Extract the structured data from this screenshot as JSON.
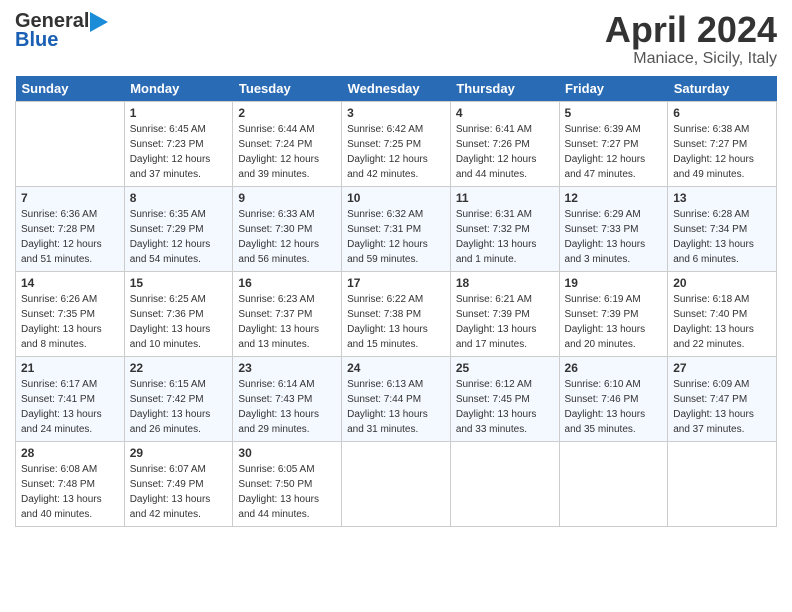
{
  "header": {
    "logo_general": "General",
    "logo_blue": "Blue",
    "month_title": "April 2024",
    "location": "Maniace, Sicily, Italy"
  },
  "days_of_week": [
    "Sunday",
    "Monday",
    "Tuesday",
    "Wednesday",
    "Thursday",
    "Friday",
    "Saturday"
  ],
  "weeks": [
    [
      {
        "num": "",
        "info": ""
      },
      {
        "num": "1",
        "info": "Sunrise: 6:45 AM\nSunset: 7:23 PM\nDaylight: 12 hours\nand 37 minutes."
      },
      {
        "num": "2",
        "info": "Sunrise: 6:44 AM\nSunset: 7:24 PM\nDaylight: 12 hours\nand 39 minutes."
      },
      {
        "num": "3",
        "info": "Sunrise: 6:42 AM\nSunset: 7:25 PM\nDaylight: 12 hours\nand 42 minutes."
      },
      {
        "num": "4",
        "info": "Sunrise: 6:41 AM\nSunset: 7:26 PM\nDaylight: 12 hours\nand 44 minutes."
      },
      {
        "num": "5",
        "info": "Sunrise: 6:39 AM\nSunset: 7:27 PM\nDaylight: 12 hours\nand 47 minutes."
      },
      {
        "num": "6",
        "info": "Sunrise: 6:38 AM\nSunset: 7:27 PM\nDaylight: 12 hours\nand 49 minutes."
      }
    ],
    [
      {
        "num": "7",
        "info": "Sunrise: 6:36 AM\nSunset: 7:28 PM\nDaylight: 12 hours\nand 51 minutes."
      },
      {
        "num": "8",
        "info": "Sunrise: 6:35 AM\nSunset: 7:29 PM\nDaylight: 12 hours\nand 54 minutes."
      },
      {
        "num": "9",
        "info": "Sunrise: 6:33 AM\nSunset: 7:30 PM\nDaylight: 12 hours\nand 56 minutes."
      },
      {
        "num": "10",
        "info": "Sunrise: 6:32 AM\nSunset: 7:31 PM\nDaylight: 12 hours\nand 59 minutes."
      },
      {
        "num": "11",
        "info": "Sunrise: 6:31 AM\nSunset: 7:32 PM\nDaylight: 13 hours\nand 1 minute."
      },
      {
        "num": "12",
        "info": "Sunrise: 6:29 AM\nSunset: 7:33 PM\nDaylight: 13 hours\nand 3 minutes."
      },
      {
        "num": "13",
        "info": "Sunrise: 6:28 AM\nSunset: 7:34 PM\nDaylight: 13 hours\nand 6 minutes."
      }
    ],
    [
      {
        "num": "14",
        "info": "Sunrise: 6:26 AM\nSunset: 7:35 PM\nDaylight: 13 hours\nand 8 minutes."
      },
      {
        "num": "15",
        "info": "Sunrise: 6:25 AM\nSunset: 7:36 PM\nDaylight: 13 hours\nand 10 minutes."
      },
      {
        "num": "16",
        "info": "Sunrise: 6:23 AM\nSunset: 7:37 PM\nDaylight: 13 hours\nand 13 minutes."
      },
      {
        "num": "17",
        "info": "Sunrise: 6:22 AM\nSunset: 7:38 PM\nDaylight: 13 hours\nand 15 minutes."
      },
      {
        "num": "18",
        "info": "Sunrise: 6:21 AM\nSunset: 7:39 PM\nDaylight: 13 hours\nand 17 minutes."
      },
      {
        "num": "19",
        "info": "Sunrise: 6:19 AM\nSunset: 7:39 PM\nDaylight: 13 hours\nand 20 minutes."
      },
      {
        "num": "20",
        "info": "Sunrise: 6:18 AM\nSunset: 7:40 PM\nDaylight: 13 hours\nand 22 minutes."
      }
    ],
    [
      {
        "num": "21",
        "info": "Sunrise: 6:17 AM\nSunset: 7:41 PM\nDaylight: 13 hours\nand 24 minutes."
      },
      {
        "num": "22",
        "info": "Sunrise: 6:15 AM\nSunset: 7:42 PM\nDaylight: 13 hours\nand 26 minutes."
      },
      {
        "num": "23",
        "info": "Sunrise: 6:14 AM\nSunset: 7:43 PM\nDaylight: 13 hours\nand 29 minutes."
      },
      {
        "num": "24",
        "info": "Sunrise: 6:13 AM\nSunset: 7:44 PM\nDaylight: 13 hours\nand 31 minutes."
      },
      {
        "num": "25",
        "info": "Sunrise: 6:12 AM\nSunset: 7:45 PM\nDaylight: 13 hours\nand 33 minutes."
      },
      {
        "num": "26",
        "info": "Sunrise: 6:10 AM\nSunset: 7:46 PM\nDaylight: 13 hours\nand 35 minutes."
      },
      {
        "num": "27",
        "info": "Sunrise: 6:09 AM\nSunset: 7:47 PM\nDaylight: 13 hours\nand 37 minutes."
      }
    ],
    [
      {
        "num": "28",
        "info": "Sunrise: 6:08 AM\nSunset: 7:48 PM\nDaylight: 13 hours\nand 40 minutes."
      },
      {
        "num": "29",
        "info": "Sunrise: 6:07 AM\nSunset: 7:49 PM\nDaylight: 13 hours\nand 42 minutes."
      },
      {
        "num": "30",
        "info": "Sunrise: 6:05 AM\nSunset: 7:50 PM\nDaylight: 13 hours\nand 44 minutes."
      },
      {
        "num": "",
        "info": ""
      },
      {
        "num": "",
        "info": ""
      },
      {
        "num": "",
        "info": ""
      },
      {
        "num": "",
        "info": ""
      }
    ]
  ]
}
